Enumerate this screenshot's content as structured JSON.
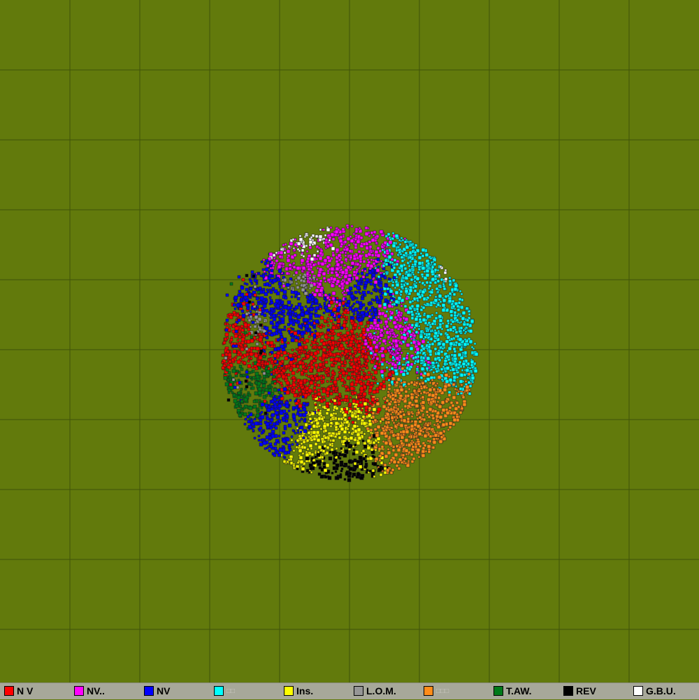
{
  "map": {
    "background": "#627a0c",
    "grid_color": "#3f520a",
    "grid_columns": 10,
    "grid_rows": 10
  },
  "factions": [
    {
      "label": "N V",
      "color": "#ff0000"
    },
    {
      "label": "NV..",
      "color": "#ff00ff"
    },
    {
      "label": "NV",
      "color": "#0000ff"
    },
    {
      "label": "□□",
      "color": "#00ffff",
      "faded": true
    },
    {
      "label": "Ins.",
      "color": "#ffff00"
    },
    {
      "label": "L.O.M.",
      "color": "#969696"
    },
    {
      "label": "□□□",
      "color": "#ff8c1a",
      "faded": true
    },
    {
      "label": "T.AW.",
      "color": "#007a1a"
    },
    {
      "label": "REV",
      "color": "#000000"
    },
    {
      "label": "G.B.U.",
      "color": "#ffffff"
    }
  ]
}
